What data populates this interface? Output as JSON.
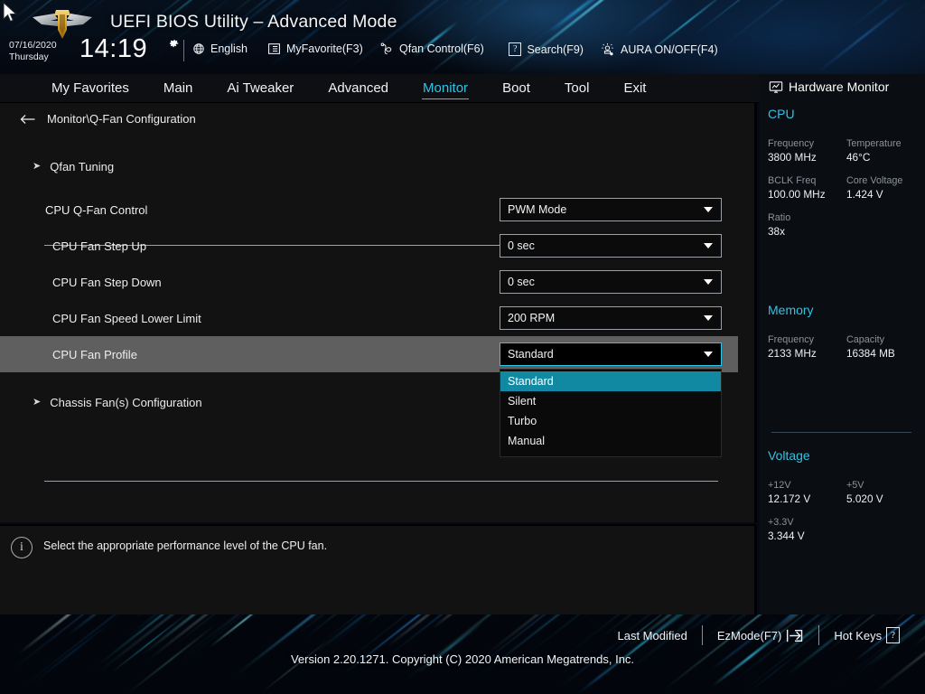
{
  "header": {
    "title": "UEFI BIOS Utility – Advanced Mode",
    "logo_name": "asus-tuf-logo",
    "date": "07/16/2020",
    "weekday": "Thursday",
    "time": "14:19",
    "gear_icon": "gear-icon",
    "items": [
      {
        "label": "English",
        "icon": "globe-icon"
      },
      {
        "label": "MyFavorite(F3)",
        "icon": "list-icon"
      },
      {
        "label": "Qfan Control(F6)",
        "icon": "fan-icon"
      },
      {
        "label": "Search(F9)",
        "icon": "question-box-icon"
      },
      {
        "label": "AURA ON/OFF(F4)",
        "icon": "aura-light-icon"
      }
    ]
  },
  "nav": {
    "tabs": [
      {
        "label": "My Favorites",
        "active": false
      },
      {
        "label": "Main",
        "active": false
      },
      {
        "label": "Ai Tweaker",
        "active": false
      },
      {
        "label": "Advanced",
        "active": false
      },
      {
        "label": "Monitor",
        "active": true
      },
      {
        "label": "Boot",
        "active": false
      },
      {
        "label": "Tool",
        "active": false
      },
      {
        "label": "Exit",
        "active": false
      }
    ],
    "active_color": "#2ec4e6"
  },
  "main": {
    "breadcrumb": "Monitor\\Q-Fan Configuration",
    "back_icon": "back-arrow-icon",
    "qfan_tuning": {
      "label": "Qfan Tuning",
      "icon": "chevron-right-icon"
    },
    "chassis_fan": {
      "label": "Chassis Fan(s) Configuration",
      "icon": "chevron-right-icon"
    },
    "settings": [
      {
        "label": "CPU Q-Fan Control",
        "value": "PWM Mode",
        "indent": 0,
        "selected": false
      },
      {
        "label": "CPU Fan Step Up",
        "value": "0 sec",
        "indent": 1,
        "selected": false
      },
      {
        "label": "CPU Fan Step Down",
        "value": "0 sec",
        "indent": 1,
        "selected": false
      },
      {
        "label": "CPU Fan Speed Lower Limit",
        "value": "200 RPM",
        "indent": 1,
        "selected": false
      },
      {
        "label": "CPU Fan Profile",
        "value": "Standard",
        "indent": 1,
        "selected": true
      }
    ],
    "dropdown": {
      "open": true,
      "selected": "Standard",
      "highlight_color": "#1189a3",
      "options": [
        "Standard",
        "Silent",
        "Turbo",
        "Manual"
      ]
    }
  },
  "help": {
    "icon": "info-icon",
    "text": "Select the appropriate performance level of the CPU fan."
  },
  "sidebar": {
    "title": "Hardware Monitor",
    "icon": "monitor-icon",
    "accent_color": "#2ec4e6",
    "sections": [
      {
        "title": "CPU",
        "fields": [
          {
            "key": "Frequency",
            "value": "3800 MHz"
          },
          {
            "key": "Temperature",
            "value": "46°C"
          },
          {
            "key": "BCLK Freq",
            "value": "100.00 MHz"
          },
          {
            "key": "Core Voltage",
            "value": "1.424 V"
          },
          {
            "key": "Ratio",
            "value": "38x"
          }
        ]
      },
      {
        "title": "Memory",
        "fields": [
          {
            "key": "Frequency",
            "value": "2133 MHz"
          },
          {
            "key": "Capacity",
            "value": "16384 MB"
          }
        ]
      },
      {
        "title": "Voltage",
        "fields": [
          {
            "key": "+12V",
            "value": "12.172 V"
          },
          {
            "key": "+5V",
            "value": "5.020 V"
          },
          {
            "key": "+3.3V",
            "value": "3.344 V"
          }
        ]
      }
    ]
  },
  "footer": {
    "buttons": [
      {
        "label": "Last Modified",
        "icon": ""
      },
      {
        "label": "EzMode(F7)",
        "icon": "exit-arrow-icon"
      },
      {
        "label": "Hot Keys",
        "icon": "question-box-icon"
      }
    ],
    "version": "Version 2.20.1271. Copyright (C) 2020 American Megatrends, Inc."
  },
  "cursor": {
    "name": "mouse-pointer"
  }
}
